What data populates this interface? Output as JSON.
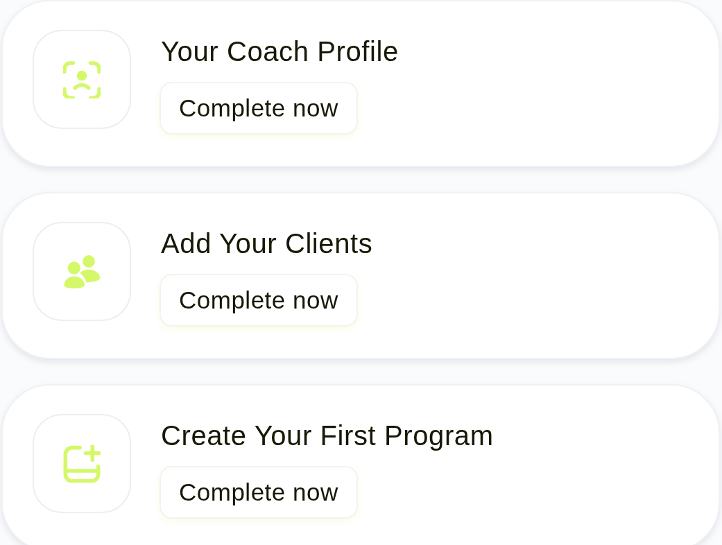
{
  "cards": [
    {
      "kind": "profile",
      "title": "Your Coach Profile",
      "button": "Complete now"
    },
    {
      "kind": "clients",
      "title": "Add Your Clients",
      "button": "Complete now"
    },
    {
      "kind": "program",
      "title": "Create Your First Program",
      "button": "Complete now"
    }
  ]
}
